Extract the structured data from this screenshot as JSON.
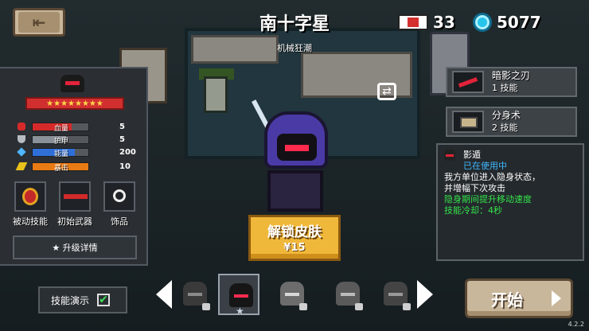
{
  "header": {
    "back_icon": "exit-door-icon",
    "title": "南十字星",
    "subtitle": "机械狂潮",
    "energy_value": "33",
    "gems_value": "5077"
  },
  "stats": {
    "stars": "★★★★★★★★",
    "rows": [
      {
        "label": "血量",
        "value": "5",
        "fill": 0.7,
        "color": "#d62a2a",
        "icon": "heart-icon"
      },
      {
        "label": "护甲",
        "value": "5",
        "fill": 0.6,
        "color": "#8b9198",
        "icon": "shield-icon"
      },
      {
        "label": "能量",
        "value": "200",
        "fill": 0.75,
        "color": "#2f6fd8",
        "icon": "diamond-icon"
      },
      {
        "label": "暴击",
        "value": "10",
        "fill": 1.0,
        "color": "#e97b14",
        "icon": "crit-icon"
      }
    ],
    "equipment": [
      {
        "label": "被动技能"
      },
      {
        "label": "初始武器"
      },
      {
        "label": "饰品"
      }
    ],
    "upgrade_label": "★ 升级详情"
  },
  "skills": [
    {
      "name": "暗影之刃",
      "sub": "1 技能"
    },
    {
      "name": "分身术",
      "sub": "2 技能"
    }
  ],
  "info": {
    "name": "影遁",
    "status": "已在使用中",
    "desc1": "我方单位进入隐身状态，",
    "desc2": "并增幅下次攻击",
    "bonus": "隐身期间提升移动速度",
    "cooldown": "技能冷却：4秒"
  },
  "unlock": {
    "label": "解锁皮肤",
    "price": "¥15"
  },
  "bottom": {
    "demo_label": "技能演示",
    "demo_checked": "✔",
    "start_label": "开始",
    "version": "4.2.2"
  },
  "colors": {
    "accent": "#f0b83a",
    "hero_eye": "#ff2b4e",
    "gem": "#27c4ea"
  }
}
